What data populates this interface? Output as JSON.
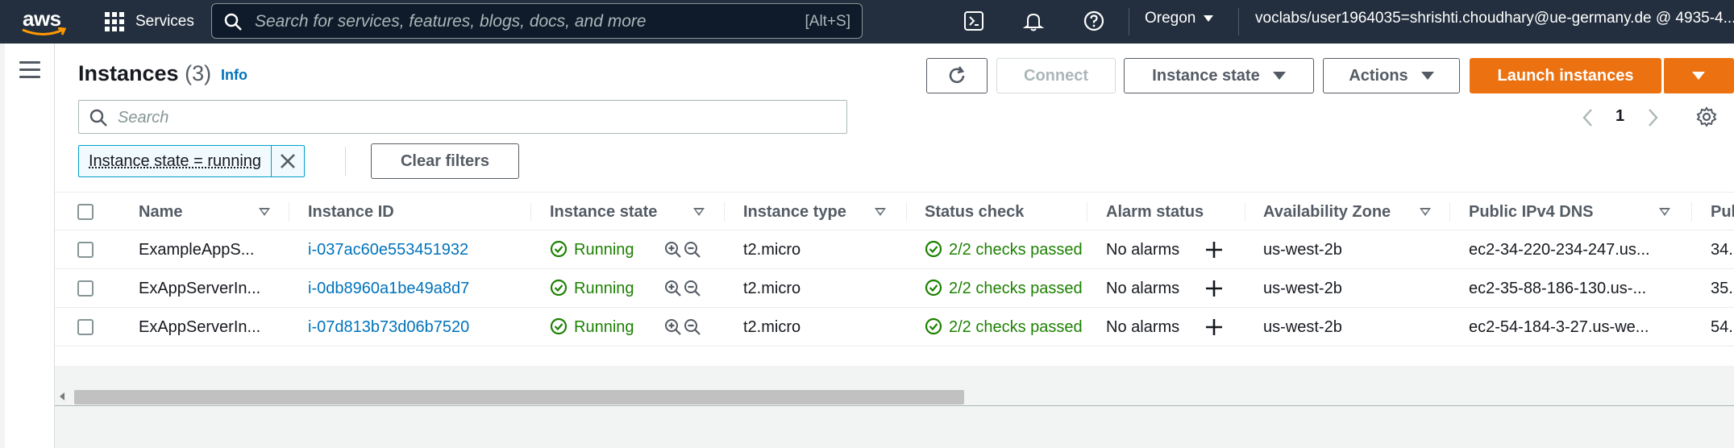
{
  "nav": {
    "logo": "aws",
    "services_label": "Services",
    "search_placeholder": "Search for services, features, blogs, docs, and more",
    "search_shortcut": "[Alt+S]",
    "region": "Oregon",
    "account": "voclabs/user1964035=shrishti.choudhary@ue-germany.de @ 4935-4..."
  },
  "header": {
    "title": "Instances",
    "count": "(3)",
    "info": "Info",
    "connect_label": "Connect",
    "instance_state_label": "Instance state",
    "actions_label": "Actions",
    "launch_label": "Launch instances"
  },
  "search": {
    "placeholder": "Search"
  },
  "pagination": {
    "page": "1"
  },
  "filter": {
    "token": "Instance state = running",
    "clear_label": "Clear filters"
  },
  "table": {
    "columns": [
      "Name",
      "Instance ID",
      "Instance state",
      "Instance type",
      "Status check",
      "Alarm status",
      "Availability Zone",
      "Public IPv4 DNS",
      "Pul"
    ],
    "rows": [
      {
        "name": "ExampleAppS...",
        "id": "i-037ac60e553451932",
        "state": "Running",
        "type": "t2.micro",
        "status": "2/2 checks passed",
        "alarm": "No alarms",
        "az": "us-west-2b",
        "dns": "ec2-34-220-234-247.us...",
        "ip": "34."
      },
      {
        "name": "ExAppServerIn...",
        "id": "i-0db8960a1be49a8d7",
        "state": "Running",
        "type": "t2.micro",
        "status": "2/2 checks passed",
        "alarm": "No alarms",
        "az": "us-west-2b",
        "dns": "ec2-35-88-186-130.us-...",
        "ip": "35."
      },
      {
        "name": "ExAppServerIn...",
        "id": "i-07d813b73d06b7520",
        "state": "Running",
        "type": "t2.micro",
        "status": "2/2 checks passed",
        "alarm": "No alarms",
        "az": "us-west-2b",
        "dns": "ec2-54-184-3-27.us-we...",
        "ip": "54."
      }
    ]
  },
  "colors": {
    "nav_bg": "#232f3e",
    "primary": "#ec7211",
    "link": "#0073bb",
    "success": "#1d8102"
  },
  "icons": [
    "grid-icon",
    "search-icon",
    "cloudshell-icon",
    "bell-icon",
    "help-icon",
    "menu-icon",
    "refresh-icon",
    "settings-icon",
    "close-icon",
    "success-icon",
    "zoom-in-icon",
    "zoom-out-icon",
    "plus-icon"
  ]
}
